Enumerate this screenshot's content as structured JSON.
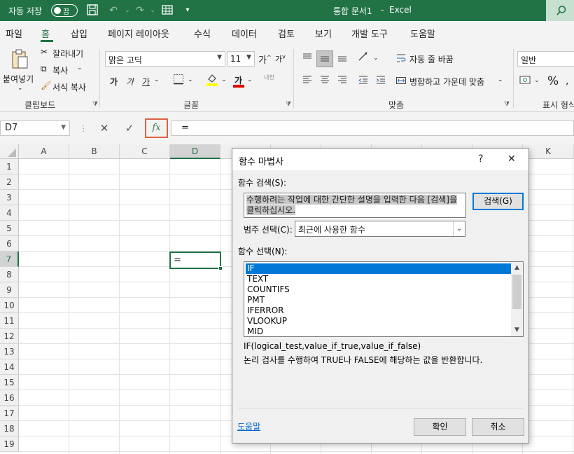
{
  "titlebar": {
    "autosave_label": "자동 저장",
    "autosave_state": "끔",
    "doc_title": "통합 문서1",
    "app_name": "Excel",
    "separator": "-",
    "bg_color": "#217346"
  },
  "menu": {
    "tabs": [
      "파일",
      "홈",
      "삽입",
      "페이지 레이아웃",
      "수식",
      "데이터",
      "검토",
      "보기",
      "개발 도구",
      "도움말"
    ],
    "active_tab": "홈"
  },
  "ribbon": {
    "clipboard": {
      "paste": "붙여넣기",
      "cut": "잘라내기",
      "copy": "복사",
      "format_painter": "서식 복사",
      "group_label": "클립보드"
    },
    "font": {
      "font_name": "맑은 고딕",
      "font_size": "11",
      "grow": "가",
      "shrink": "가",
      "bold": "가",
      "italic": "가",
      "underline": "가",
      "font_color_glyph": "가",
      "phonetic": "내천",
      "group_label": "글꼴"
    },
    "alignment": {
      "wrap_text": "자동 줄 바꿈",
      "merge_center": "병합하고 가운데 맞춤",
      "group_label": "맞춤"
    },
    "number": {
      "format": "일반",
      "percent": "%",
      "group_label": "표시 형식"
    }
  },
  "formula_bar": {
    "name_box": "D7",
    "cancel": "✕",
    "enter": "✓",
    "fx": "fx",
    "content": "="
  },
  "grid": {
    "columns": [
      "A",
      "B",
      "C",
      "D",
      "E",
      "F",
      "G",
      "H",
      "I",
      "J",
      "K"
    ],
    "rows": [
      "1",
      "2",
      "3",
      "4",
      "5",
      "6",
      "7",
      "8",
      "9",
      "10",
      "11",
      "12",
      "13",
      "14",
      "15",
      "16",
      "17",
      "18",
      "19"
    ],
    "active_cell": "D7",
    "active_cell_value": "="
  },
  "dialog": {
    "title": "함수 마법사",
    "help_glyph": "?",
    "close_glyph": "✕",
    "search_label": "함수 검색(S):",
    "search_placeholder": "수행하려는 작업에 대한 간단한 설명을 입력한 다음 [검색]을 클릭하십시오.",
    "search_button": "검색(G)",
    "category_label": "범주 선택(C):",
    "category_value": "최근에 사용한 함수",
    "function_label": "함수 선택(N):",
    "functions": [
      "IF",
      "TEXT",
      "COUNTIFS",
      "PMT",
      "IFERROR",
      "VLOOKUP",
      "MID"
    ],
    "selected_function": "IF",
    "syntax": "IF(logical_test,value_if_true,value_if_false)",
    "description": "논리 검사를 수행하여 TRUE나 FALSE에 해당하는 값을 반환합니다.",
    "help_link": "도움말",
    "ok": "확인",
    "cancel": "취소"
  }
}
